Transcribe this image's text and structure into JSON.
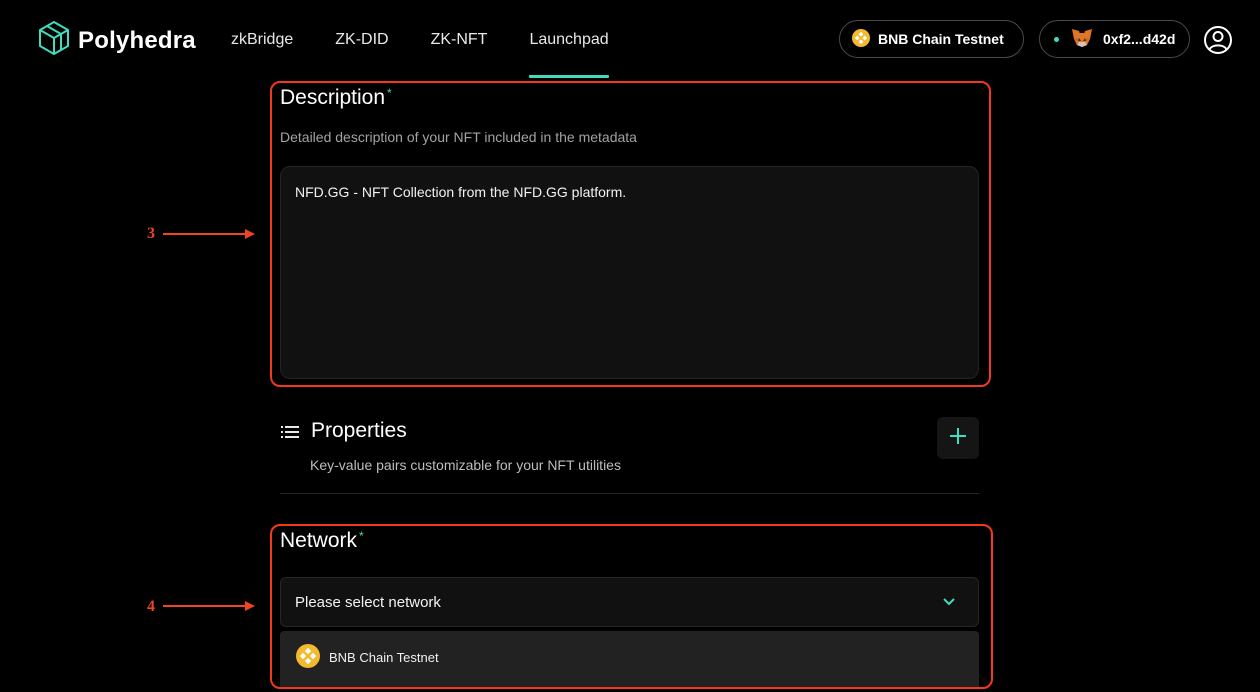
{
  "brand": {
    "name": "Polyhedra",
    "accent": "#3fdcbf"
  },
  "nav": {
    "links": [
      {
        "label": "zkBridge"
      },
      {
        "label": "ZK-DID"
      },
      {
        "label": "ZK-NFT"
      },
      {
        "label": "Launchpad",
        "active": true
      }
    ],
    "chain_button": {
      "label": "BNB Chain Testnet",
      "icon": "bnb-icon"
    },
    "wallet_button": {
      "label": "0xf2...d42d",
      "icon": "metamask-fox-icon"
    },
    "user_icon": "user-circle-icon"
  },
  "annotations": {
    "step3": "3",
    "step4": "4",
    "color": "#f2391c"
  },
  "description": {
    "title": "Description",
    "required_mark": "*",
    "subtitle": "Detailed description of your NFT included in the metadata",
    "value": "NFD.GG - NFT Collection from the NFD.GG platform."
  },
  "properties": {
    "title": "Properties",
    "subtitle": "Key-value pairs customizable for your NFT utilities",
    "icon": "list-icon",
    "add_icon": "plus-icon"
  },
  "network": {
    "title": "Network",
    "required_mark": "*",
    "placeholder": "Please select network",
    "options": [
      {
        "label": "BNB Chain Testnet",
        "icon": "bnb-icon"
      }
    ]
  }
}
